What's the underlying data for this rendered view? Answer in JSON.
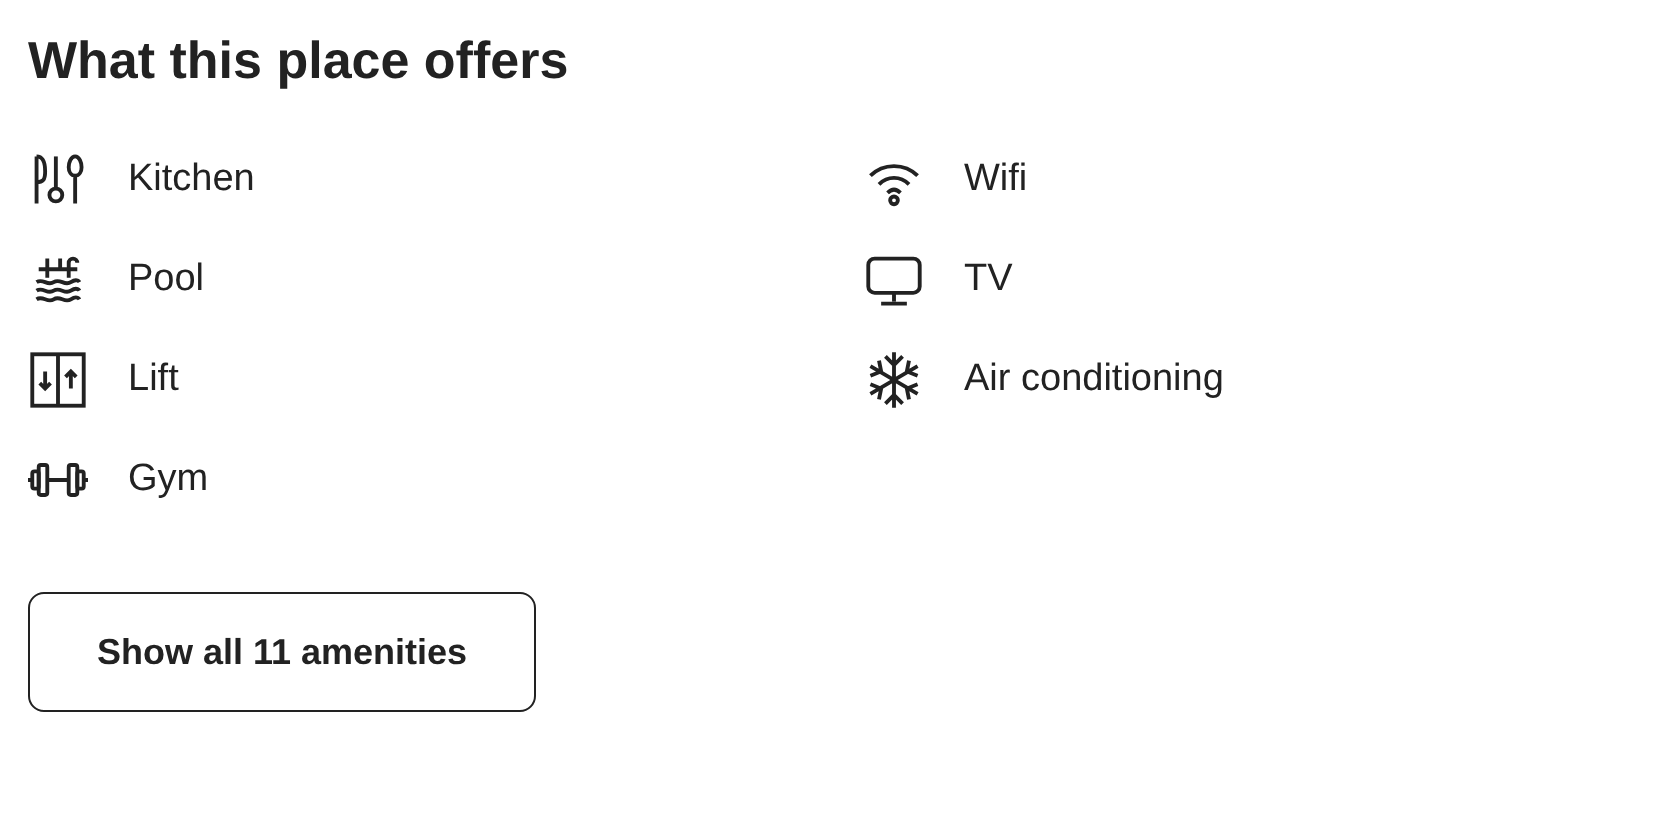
{
  "heading": "What this place offers",
  "amenities": [
    {
      "label": "Kitchen",
      "kind": "kitchen"
    },
    {
      "label": "Wifi",
      "kind": "wifi"
    },
    {
      "label": "Pool",
      "kind": "pool"
    },
    {
      "label": "TV",
      "kind": "tv"
    },
    {
      "label": "Lift",
      "kind": "lift"
    },
    {
      "label": "Air conditioning",
      "kind": "snowflake"
    },
    {
      "label": "Gym",
      "kind": "gym"
    }
  ],
  "button": "Show all 11 amenities"
}
